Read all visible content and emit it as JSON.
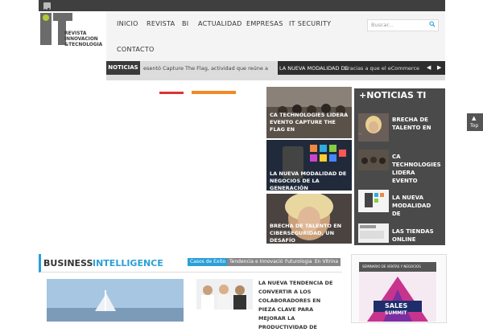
{
  "topbar": {
    "social_icon": "twitter-icon"
  },
  "logo": {
    "line1": "REVISTA",
    "line2": "INNOVACION",
    "line3": "&TECNOLOGIA"
  },
  "nav": {
    "items": [
      "INICIO",
      "REVISTA",
      "BI",
      "ACTUALIDAD",
      "EMPRESAS",
      "IT SECURITY"
    ],
    "contacto": "CONTACTO"
  },
  "search": {
    "placeholder": "Buscar..."
  },
  "ticker": {
    "label": "NOTICIAS",
    "item1": "esentó Capture The Flag, actividad que reúne a",
    "item2": "LA NUEVA MODALIDAD DE",
    "item3": "Gracias a que el eCommerce"
  },
  "tiles": [
    {
      "caption": "CA TECHNOLOGIES LIDERA EVENTO CAPTURE THE FLAG EN"
    },
    {
      "caption": "LA NUEVA MODALIDAD DE NEGOCIOS DE LA GENERACIÓN"
    },
    {
      "caption": "BRECHA DE TALENTO EN CIBERSEGURIDAD, UN DESAFÍO"
    }
  ],
  "sidebar": {
    "title": "+NOTICIAS TI",
    "items": [
      {
        "title": "BRECHA DE TALENTO EN"
      },
      {
        "title": "CA TECHNOLOGIES LIDERA EVENTO"
      },
      {
        "title": "LA NUEVA MODALIDAD DE"
      },
      {
        "title": "LAS TIENDAS ONLINE"
      }
    ]
  },
  "top_button": {
    "label": "Top"
  },
  "bi": {
    "title_part1": "BUSINESS",
    "title_part2": "INTELLIGENCE",
    "tabs": [
      "Casos de Exito",
      "Tendencia e Innovación",
      "Futurologia",
      "En Vitrina"
    ],
    "article_title": "LA NUEVA TENDENCIA DE CONVERTIR A LOS COLABORADORES EN PIEZA CLAVE PARA MEJORAR LA PRODUCTIVIDAD DE"
  },
  "ad": {
    "line1": "SEMINARIO DE VENTAS Y NEGOCIOS",
    "line2": "SALES",
    "line3": "SUMMIT"
  },
  "colors": {
    "accent": "#2a9fd8",
    "dark": "#3f3f3f"
  }
}
